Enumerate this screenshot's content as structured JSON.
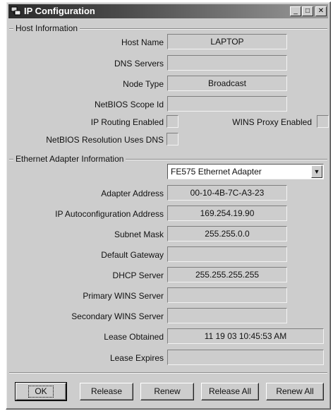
{
  "window": {
    "title": "IP Configuration"
  },
  "host_info": {
    "legend": "Host Information",
    "fields": [
      {
        "label": "Host Name",
        "value": "LAPTOP"
      },
      {
        "label": "DNS Servers",
        "value": ""
      },
      {
        "label": "Node Type",
        "value": "Broadcast"
      },
      {
        "label": "NetBIOS Scope Id",
        "value": ""
      }
    ],
    "ip_routing_label": "IP Routing Enabled",
    "wins_proxy_label": "WINS Proxy Enabled",
    "netbios_dns_label": "NetBIOS Resolution Uses DNS"
  },
  "adapter_info": {
    "legend": "Ethernet  Adapter Information",
    "selected_adapter": "FE575 Ethernet Adapter",
    "fields": [
      {
        "label": "Adapter Address",
        "value": "00-10-4B-7C-A3-23"
      },
      {
        "label": "IP Autoconfiguration Address",
        "value": "169.254.19.90"
      },
      {
        "label": "Subnet Mask",
        "value": "255.255.0.0"
      },
      {
        "label": "Default Gateway",
        "value": ""
      },
      {
        "label": "DHCP Server",
        "value": "255.255.255.255"
      },
      {
        "label": "Primary WINS Server",
        "value": ""
      },
      {
        "label": "Secondary WINS Server",
        "value": ""
      },
      {
        "label": "Lease Obtained",
        "value": "11 19 03 10:45:53 AM"
      },
      {
        "label": "Lease Expires",
        "value": ""
      }
    ]
  },
  "buttons": {
    "ok": "OK",
    "release": "Release",
    "renew": "Renew",
    "release_all": "Release All",
    "renew_all": "Renew All"
  },
  "icons": {
    "app": "network-icon",
    "minimize": "minimize-icon",
    "maximize": "maximize-icon",
    "close": "close-icon",
    "dropdown": "dropdown-arrow-icon"
  }
}
